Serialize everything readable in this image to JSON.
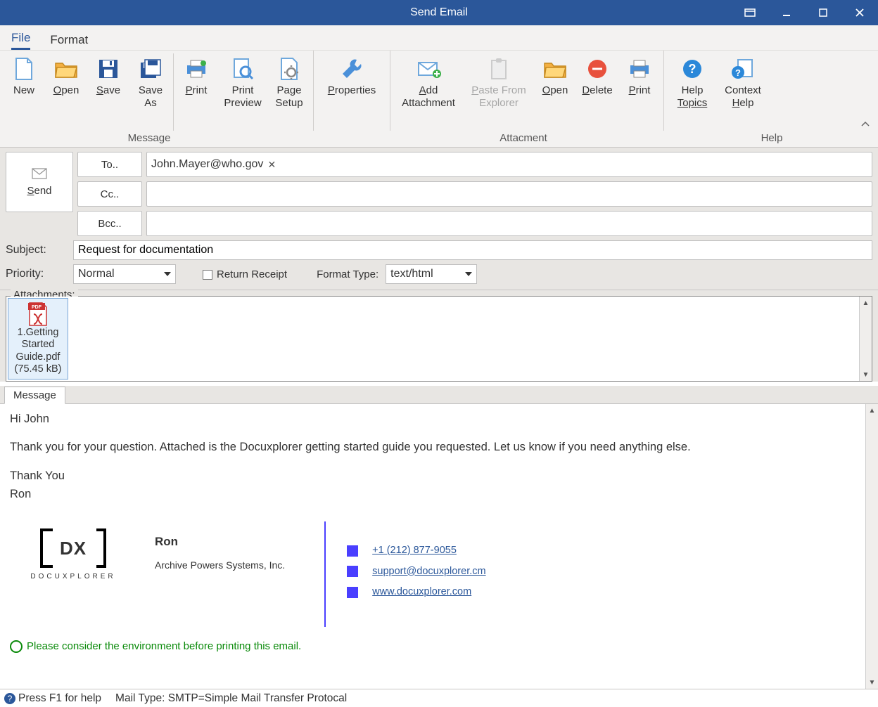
{
  "window": {
    "title": "Send Email"
  },
  "menu": {
    "file": "File",
    "format": "Format"
  },
  "ribbon": {
    "new": "New",
    "open": "Open",
    "save": "Save",
    "save_as_l1": "Save",
    "save_as_l2": "As",
    "print": "Print",
    "print_preview_l1": "Print",
    "print_preview_l2": "Preview",
    "page_setup_l1": "Page",
    "page_setup_l2": "Setup",
    "properties": "Properties",
    "add_attach_l1": "Add",
    "add_attach_l2": "Attachment",
    "paste_from_l1": "Paste From",
    "paste_from_l2": "Explorer",
    "open2": "Open",
    "delete": "Delete",
    "print2": "Print",
    "help_topics_l1": "Help",
    "help_topics_l2": "Topics",
    "context_help_l1": "Context",
    "context_help_l2": "Help",
    "group_message": "Message",
    "group_attachment": "Attacment",
    "group_help": "Help"
  },
  "fields": {
    "send": "Send",
    "to_label": "To..",
    "cc_label": "Cc..",
    "bcc_label": "Bcc..",
    "to_value": "John.Mayer@who.gov",
    "subject_label": "Subject:",
    "subject_value": "Request for documentation",
    "priority_label": "Priority:",
    "priority_value": "Normal",
    "return_receipt": "Return Receipt",
    "format_type_label": "Format Type:",
    "format_type_value": "text/html",
    "attachments_label": "Attachments:"
  },
  "attachment": {
    "name_l1": "1.Getting",
    "name_l2": "Started",
    "name_l3": "Guide.pdf",
    "size": "(75.45 kB)"
  },
  "tabs": {
    "message": "Message"
  },
  "body": {
    "greeting": "Hi John",
    "para1a": "Thank you for your question. ",
    "para1b": "Attached is the Docuxplorer getting started guide you requested. ",
    "para1c": "Let us know if you need anything else.",
    "thanks": "Thank You",
    "signoff": "Ron"
  },
  "signature": {
    "brand": "DOCUXPLORER",
    "name": "Ron",
    "company": "Archive Powers Systems, Inc.",
    "phone": "+1 (212) 877-9055",
    "email": "support@docuxplorer.cm",
    "web": "www.docuxplorer.com",
    "env_note": "Please consider the environment before printing this email."
  },
  "status": {
    "help": "Press F1 for help",
    "mail_type": "Mail Type: SMTP=Simple Mail Transfer Protocal"
  }
}
